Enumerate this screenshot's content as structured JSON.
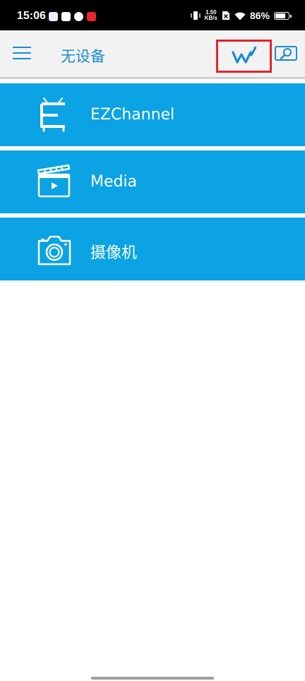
{
  "status_bar": {
    "time": "15:06",
    "net_speed_value": "1.50",
    "net_speed_unit": "KB/s",
    "battery_percent": "86%",
    "battery_level": 0.86
  },
  "app_bar": {
    "title": "无设备"
  },
  "menu": [
    {
      "label": "EZChannel",
      "icon": "tv-icon"
    },
    {
      "label": "Media",
      "icon": "clapperboard-icon"
    },
    {
      "label": "摄像机",
      "icon": "camera-icon"
    }
  ],
  "colors": {
    "accent": "#1b8bd0",
    "item_background": "#0ba3e3",
    "highlight_border": "#e0242c"
  }
}
